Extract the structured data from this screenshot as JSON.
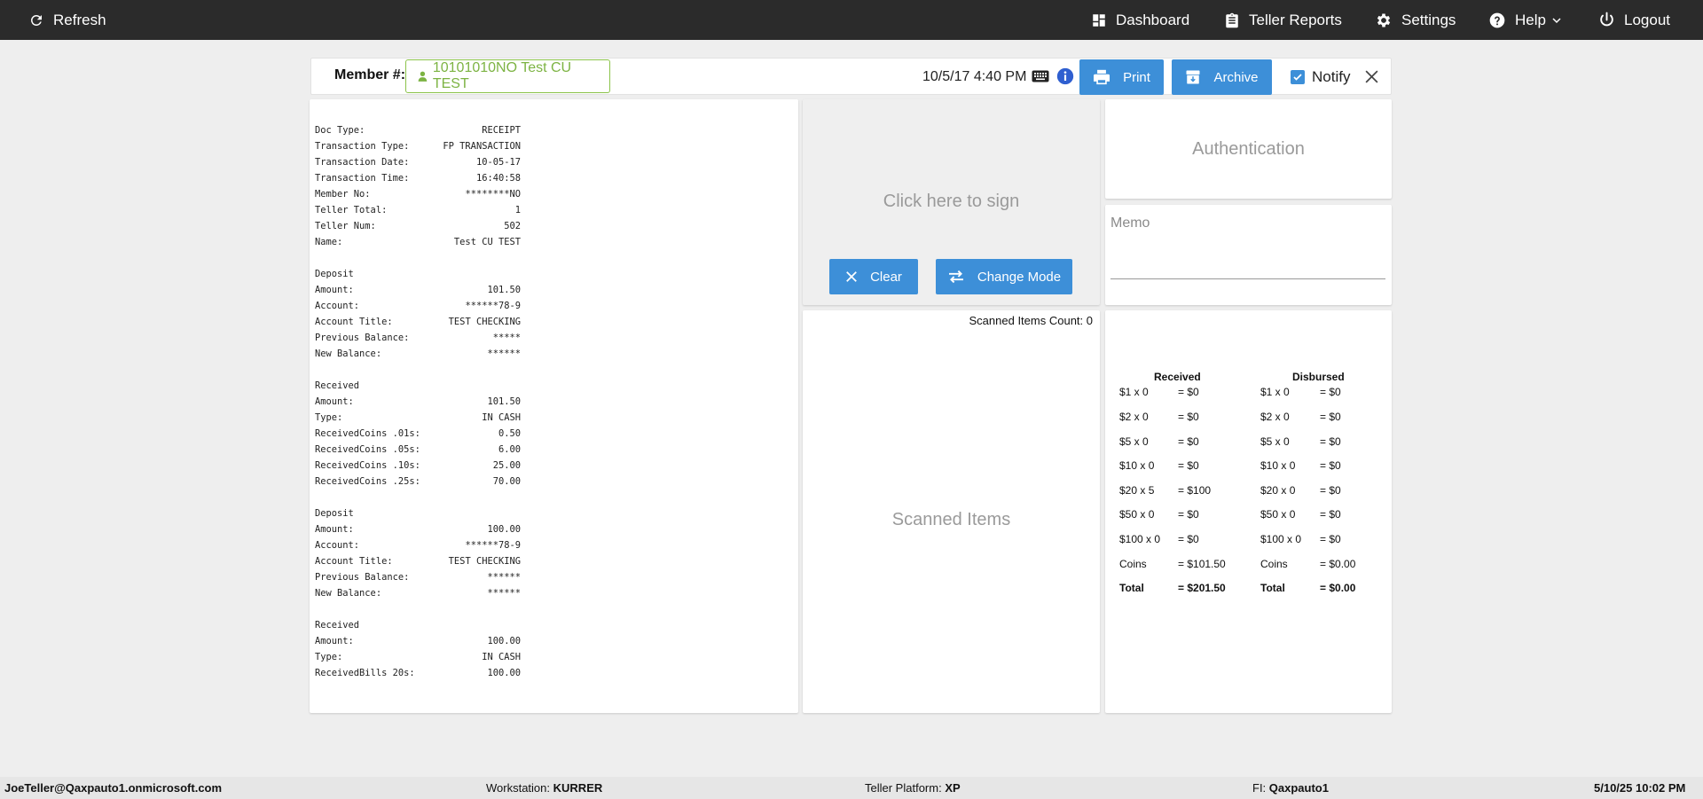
{
  "topbar": {
    "refresh": "Refresh",
    "dashboard": "Dashboard",
    "teller_reports": "Teller Reports",
    "settings": "Settings",
    "help": "Help",
    "logout": "Logout"
  },
  "member": {
    "label": "Member #:",
    "value": "10101010NO Test CU TEST",
    "datetime": "10/5/17 4:40 PM",
    "print": "Print",
    "archive": "Archive",
    "notify": "Notify"
  },
  "receipt": [
    [
      "Doc Type:",
      "RECEIPT"
    ],
    [
      "Transaction Type:",
      "FP TRANSACTION"
    ],
    [
      "Transaction Date:",
      "10-05-17"
    ],
    [
      "Transaction Time:",
      "16:40:58"
    ],
    [
      "Member No:",
      "********NO"
    ],
    [
      "Teller Total:",
      "1"
    ],
    [
      "Teller Num:",
      "502"
    ],
    [
      "Name:",
      "Test CU TEST"
    ],
    [
      "",
      ""
    ],
    [
      "Deposit",
      ""
    ],
    [
      "Amount:",
      "101.50"
    ],
    [
      "Account:",
      "******78-9"
    ],
    [
      "Account Title:",
      "TEST CHECKING"
    ],
    [
      "Previous Balance:",
      "*****"
    ],
    [
      "New Balance:",
      "******"
    ],
    [
      "",
      ""
    ],
    [
      "Received",
      ""
    ],
    [
      "Amount:",
      "101.50"
    ],
    [
      "Type:",
      "IN CASH"
    ],
    [
      "ReceivedCoins .01s:",
      "0.50"
    ],
    [
      "ReceivedCoins .05s:",
      "6.00"
    ],
    [
      "ReceivedCoins .10s:",
      "25.00"
    ],
    [
      "ReceivedCoins .25s:",
      "70.00"
    ],
    [
      "",
      ""
    ],
    [
      "Deposit",
      ""
    ],
    [
      "Amount:",
      "100.00"
    ],
    [
      "Account:",
      "******78-9"
    ],
    [
      "Account Title:",
      "TEST CHECKING"
    ],
    [
      "Previous Balance:",
      "******"
    ],
    [
      "New Balance:",
      "******"
    ],
    [
      "",
      ""
    ],
    [
      "Received",
      ""
    ],
    [
      "Amount:",
      "100.00"
    ],
    [
      "Type:",
      "IN CASH"
    ],
    [
      "ReceivedBills 20s:",
      "100.00"
    ]
  ],
  "sign": {
    "prompt": "Click here to sign",
    "clear": "Clear",
    "change_mode": "Change Mode"
  },
  "scanned": {
    "count_label": "Scanned Items Count: 0",
    "title": "Scanned Items"
  },
  "auth": {
    "title": "Authentication"
  },
  "memo": {
    "placeholder": "Memo"
  },
  "cash": {
    "received_header": "Received",
    "disbursed_header": "Disbursed",
    "rows": [
      [
        "$1 x 0",
        "= $0",
        "$1 x 0",
        "= $0"
      ],
      [
        "$2 x 0",
        "= $0",
        "$2 x 0",
        "= $0"
      ],
      [
        "$5 x 0",
        "= $0",
        "$5 x 0",
        "= $0"
      ],
      [
        "$10 x 0",
        "= $0",
        "$10 x 0",
        "= $0"
      ],
      [
        "$20 x 5",
        "= $100",
        "$20 x 0",
        "= $0"
      ],
      [
        "$50 x 0",
        "= $0",
        "$50 x 0",
        "= $0"
      ],
      [
        "$100 x 0",
        "= $0",
        "$100 x 0",
        "= $0"
      ],
      [
        "Coins",
        "= $101.50",
        "Coins",
        "= $0.00"
      ],
      [
        "Total",
        "= $201.50",
        "Total",
        "= $0.00"
      ]
    ]
  },
  "footer": {
    "user": "JoeTeller@Qaxpauto1.onmicrosoft.com",
    "workstation_label": "Workstation:",
    "workstation": "KURRER",
    "platform_label": "Teller Platform:",
    "platform": "XP",
    "fi_label": "FI:",
    "fi": "Qaxpauto1",
    "datetime": "5/10/25 10:02 PM"
  },
  "colors": {
    "topbar": "#2b2b2b",
    "accent_blue": "#3d8fd8",
    "member_green": "#7cb342"
  }
}
